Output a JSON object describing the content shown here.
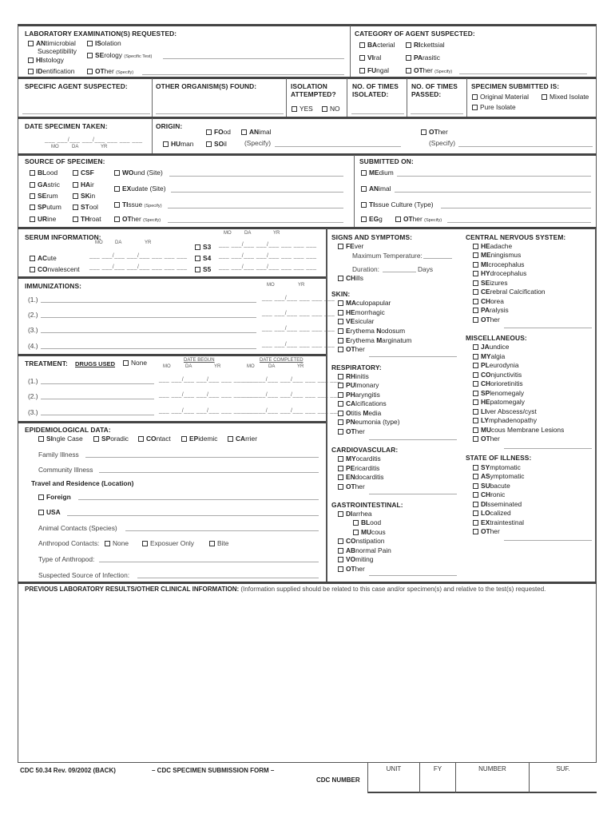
{
  "lab_exam": {
    "title": "LABORATORY EXAMINATION(S) REQUESTED:",
    "options": [
      {
        "bold": "AN",
        "rest": "timicrobial Susceptibility"
      },
      {
        "bold": "HI",
        "rest": "stology"
      },
      {
        "bold": "ID",
        "rest": "entification"
      },
      {
        "bold": "IS",
        "rest": "olation"
      },
      {
        "bold": "SE",
        "rest": "rology",
        "note": "(Specific Test)"
      },
      {
        "bold": "OT",
        "rest": "her",
        "note": "(Specify)"
      }
    ],
    "antimicrobial_line2": "Susceptibility"
  },
  "agent_category": {
    "title": "CATEGORY OF AGENT SUSPECTED:",
    "options": [
      {
        "bold": "BA",
        "rest": "cterial"
      },
      {
        "bold": "RI",
        "rest": "ckettsial"
      },
      {
        "bold": "VI",
        "rest": "ral"
      },
      {
        "bold": "PA",
        "rest": "rasitic"
      },
      {
        "bold": "FU",
        "rest": "ngal"
      },
      {
        "bold": "OT",
        "rest": "her",
        "note": "(Specify)"
      }
    ]
  },
  "row2": {
    "specific_agent": "SPECIFIC AGENT SUSPECTED:",
    "other_organisms": "OTHER ORGANISM(S) FOUND:",
    "isolation_attempted_1": "ISOLATION",
    "isolation_attempted_2": "ATTEMPTED?",
    "yes": "YES",
    "no": "NO",
    "times_isolated_1": "NO. OF TIMES",
    "times_isolated_2": "ISOLATED:",
    "times_passed_1": "NO. OF TIMES",
    "times_passed_2": "PASSED:",
    "specimen_submitted": "SPECIMEN SUBMITTED IS:",
    "original_material": "Original Material",
    "mixed_isolate": "Mixed Isolate",
    "pure_isolate": "Pure Isolate"
  },
  "row3": {
    "date_taken": "DATE SPECIMEN TAKEN:",
    "mo": "MO",
    "da": "DA",
    "yr": "YR",
    "date_blank": "___ ___/___ ___/___ ___ ___ ___",
    "origin": "ORIGIN:",
    "food_b": "FO",
    "food_r": "od",
    "animal_b": "AN",
    "animal_r": "imal",
    "human_b": "HU",
    "human_r": "man",
    "soil_b": "SO",
    "soil_r": "il",
    "other_b": "OT",
    "other_r": "her",
    "specify": "(Specify)"
  },
  "source": {
    "title": "SOURCE OF SPECIMEN:",
    "col1": [
      {
        "bold": "BL",
        "rest": "ood"
      },
      {
        "bold": "GA",
        "rest": "stric"
      },
      {
        "bold": "SE",
        "rest": "rum"
      },
      {
        "bold": "SP",
        "rest": "utum"
      },
      {
        "bold": "UR",
        "rest": "ine"
      }
    ],
    "col2": [
      {
        "bold": "CSF",
        "rest": ""
      },
      {
        "bold": "HA",
        "rest": "ir"
      },
      {
        "bold": "SK",
        "rest": "in"
      },
      {
        "bold": "ST",
        "rest": "ool"
      },
      {
        "bold": "TH",
        "rest": "roat"
      }
    ],
    "col3": [
      {
        "bold": "WO",
        "rest": "und (Site)",
        "note": ""
      },
      {
        "bold": "EX",
        "rest": "udate (Site)",
        "note": ""
      },
      {
        "bold": "TI",
        "rest": "ssue",
        "note": "(Specify)"
      },
      {
        "bold": "OT",
        "rest": "her",
        "note": "(Specify)"
      }
    ]
  },
  "submitted_on": {
    "title": "SUBMITTED ON:",
    "medium_b": "ME",
    "medium_r": "dium",
    "animal_b": "AN",
    "animal_r": "imal",
    "tissue_b": "TI",
    "tissue_r": "ssue Culture (Type)",
    "egg_b": "EG",
    "egg_r": "g",
    "other_b": "OT",
    "other_r": "her",
    "other_note": "(Specify)"
  },
  "serum": {
    "title": "SERUM INFORMATION:",
    "mo": "MO",
    "da": "DA",
    "yr": "YR",
    "date_blank": "___ ___/___ ___/___ ___ ___ ___",
    "acute_b": "AC",
    "acute_r": "ute",
    "conv_b": "CO",
    "conv_r": "nvalescent",
    "s3": "S3",
    "s4": "S4",
    "s5": "S5"
  },
  "immunizations": {
    "title": "IMMUNIZATIONS:",
    "mo": "MO",
    "yr": "YR",
    "items": [
      "(1.)",
      "(2.)",
      "(3.)",
      "(4.)"
    ],
    "date_blank": "___ ___/___ ___ ___ ___"
  },
  "treatment": {
    "title": "TREATMENT:",
    "drugs_used": "DRUGS USED",
    "none": "None",
    "date_begun": "DATE BEGUN",
    "date_completed": "DATE COMPLETED",
    "mo": "MO",
    "da": "DA",
    "yr": "YR",
    "items": [
      "(1.)",
      "(2.)",
      "(3.)"
    ],
    "date_blank": "___ ___/___ ___/___ ___ ___ ___"
  },
  "epi": {
    "title": "EPIDEMIOLOGICAL DATA:",
    "types": [
      {
        "bold": "SI",
        "rest": "ngle Case"
      },
      {
        "bold": "SP",
        "rest": "oradic"
      },
      {
        "bold": "CO",
        "rest": "ntact"
      },
      {
        "bold": "EP",
        "rest": "idemic"
      },
      {
        "bold": "CA",
        "rest": "rrier"
      }
    ],
    "family_illness": "Family Illness",
    "community_illness": "Community Illness",
    "travel": "Travel and Residence (Location)",
    "foreign": "Foreign",
    "usa": "USA",
    "animal_contacts": "Animal Contacts (Species)",
    "anthropod_contacts": "Anthropod Contacts:",
    "none": "None",
    "exposure_only": "Exposuer Only",
    "bite": "Bite",
    "type_anthropod": "Type of Anthropod:",
    "suspected_source": "Suspected Source of Infection:"
  },
  "signs": {
    "title": "SIGNS AND SYMPTOMS:",
    "fever_b": "FE",
    "fever_r": "ver",
    "max_temp": "Maximum Temperature:",
    "duration": "Duration:",
    "days": "Days",
    "chills_b": "CH",
    "chills_r": "ills"
  },
  "skin": {
    "title": "SKIN:",
    "items": [
      {
        "bold": "MA",
        "rest": "culopapular"
      },
      {
        "bold": "HE",
        "rest": "morrhagic"
      },
      {
        "bold": "VE",
        "rest": "sicular"
      },
      {
        "bold": "E",
        "rest": "rythema ",
        "bold2": "N",
        "rest2": "odosum"
      },
      {
        "bold": "E",
        "rest": "rythema ",
        "bold2": "M",
        "rest2": "arginatum"
      },
      {
        "bold": "OT",
        "rest": "her"
      }
    ]
  },
  "respiratory": {
    "title": "RESPIRATORY:",
    "items": [
      {
        "bold": "RH",
        "rest": "initis"
      },
      {
        "bold": "PU",
        "rest": "lmonary"
      },
      {
        "bold": "PH",
        "rest": "aryngitis"
      },
      {
        "bold": "CA",
        "rest": "lcifications"
      },
      {
        "bold": "O",
        "rest": "titis ",
        "bold2": "M",
        "rest2": "edia"
      },
      {
        "bold": "PN",
        "rest": "eumonia (type)"
      },
      {
        "bold": "OT",
        "rest": "her"
      }
    ]
  },
  "cardio": {
    "title": "CARDIOVASCULAR:",
    "items": [
      {
        "bold": "MY",
        "rest": "ocarditis"
      },
      {
        "bold": "PE",
        "rest": "ricarditis"
      },
      {
        "bold": "EN",
        "rest": "docarditis"
      },
      {
        "bold": "OT",
        "rest": "her"
      }
    ]
  },
  "gi": {
    "title": "GASTROINTESTINAL:",
    "diarrhea_b": "DI",
    "diarrhea_r": "arrhea",
    "blood_b": "BL",
    "blood_r": "ood",
    "mucous_b": "MU",
    "mucous_r": "cous",
    "items": [
      {
        "bold": "CO",
        "rest": "nstipation"
      },
      {
        "bold": "AB",
        "rest": "normal Pain"
      },
      {
        "bold": "VO",
        "rest": "miting"
      },
      {
        "bold": "OT",
        "rest": "her"
      }
    ]
  },
  "cns": {
    "title": "CENTRAL NERVOUS SYSTEM:",
    "items": [
      {
        "bold": "HE",
        "rest": "adache"
      },
      {
        "bold": "ME",
        "rest": "ningismus"
      },
      {
        "bold": "MI",
        "rest": "crocephalus"
      },
      {
        "bold": "HY",
        "rest": "drocephalus"
      },
      {
        "bold": "SE",
        "rest": "izures"
      },
      {
        "bold": "CE",
        "rest": "rebral Calcification"
      },
      {
        "bold": "CH",
        "rest": "orea"
      },
      {
        "bold": "PA",
        "rest": "ralysis"
      },
      {
        "bold": "OT",
        "rest": "her"
      }
    ]
  },
  "misc": {
    "title": "MISCELLANEOUS:",
    "items": [
      {
        "bold": "JA",
        "rest": "undice"
      },
      {
        "bold": "MY",
        "rest": "algia"
      },
      {
        "bold": "PL",
        "rest": "eurodynia"
      },
      {
        "bold": "CO",
        "rest": "njunctivitis"
      },
      {
        "bold": "CH",
        "rest": "orioretinitis"
      },
      {
        "bold": "SP",
        "rest": "lenomegaly"
      },
      {
        "bold": "HE",
        "rest": "patomegaly"
      },
      {
        "bold": "LI",
        "rest": "ver Abscess/cyst"
      },
      {
        "bold": "LY",
        "rest": "mphadenopathy"
      },
      {
        "bold": "MU",
        "rest": "cous Membrane Lesions"
      },
      {
        "bold": "OT",
        "rest": "her"
      }
    ]
  },
  "state": {
    "title": "STATE OF ILLNESS:",
    "items": [
      {
        "bold": "SY",
        "rest": "mptomatic"
      },
      {
        "bold": "AS",
        "rest": "ymptomatic"
      },
      {
        "bold": "SU",
        "rest": "bacute"
      },
      {
        "bold": "CH",
        "rest": "ronic"
      },
      {
        "bold": "DI",
        "rest": "sseminated"
      },
      {
        "bold": "LO",
        "rest": "calized"
      },
      {
        "bold": "EX",
        "rest": "traintestinal"
      },
      {
        "bold": "OT",
        "rest": "her"
      }
    ]
  },
  "previous": {
    "title": "PREVIOUS LABORATORY RESULTS/OTHER CLINICAL INFORMATION:",
    "note": "(Information supplied should be related to this case and/or specimen(s) and relative to the test(s) requested."
  },
  "footer": {
    "form_id": "CDC 50.34  Rev. 09/2002 (BACK)",
    "form_name": "– CDC SPECIMEN SUBMISSION FORM –",
    "cdc_number": "CDC NUMBER",
    "cols": [
      "UNIT",
      "FY",
      "NUMBER",
      "SUF."
    ]
  }
}
